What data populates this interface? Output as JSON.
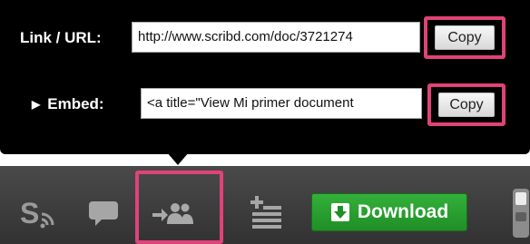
{
  "share_panel": {
    "link_label": "Link / URL:",
    "link_value": "http://www.scribd.com/doc/3721274",
    "embed_label": "Embed:",
    "embed_value": "<a title=\"View Mi primer document",
    "copy_label": "Copy",
    "embed_expand_icon": "triangle-right-icon"
  },
  "toolbar": {
    "download_label": "Download",
    "icons": [
      "scribd-feed-icon",
      "comment-icon",
      "share-people-icon",
      "add-to-collection-icon",
      "download-arrow-icon",
      "toggle-switch-icon"
    ],
    "download_color": "#27a32e",
    "highlight_color": "#e0427a"
  }
}
